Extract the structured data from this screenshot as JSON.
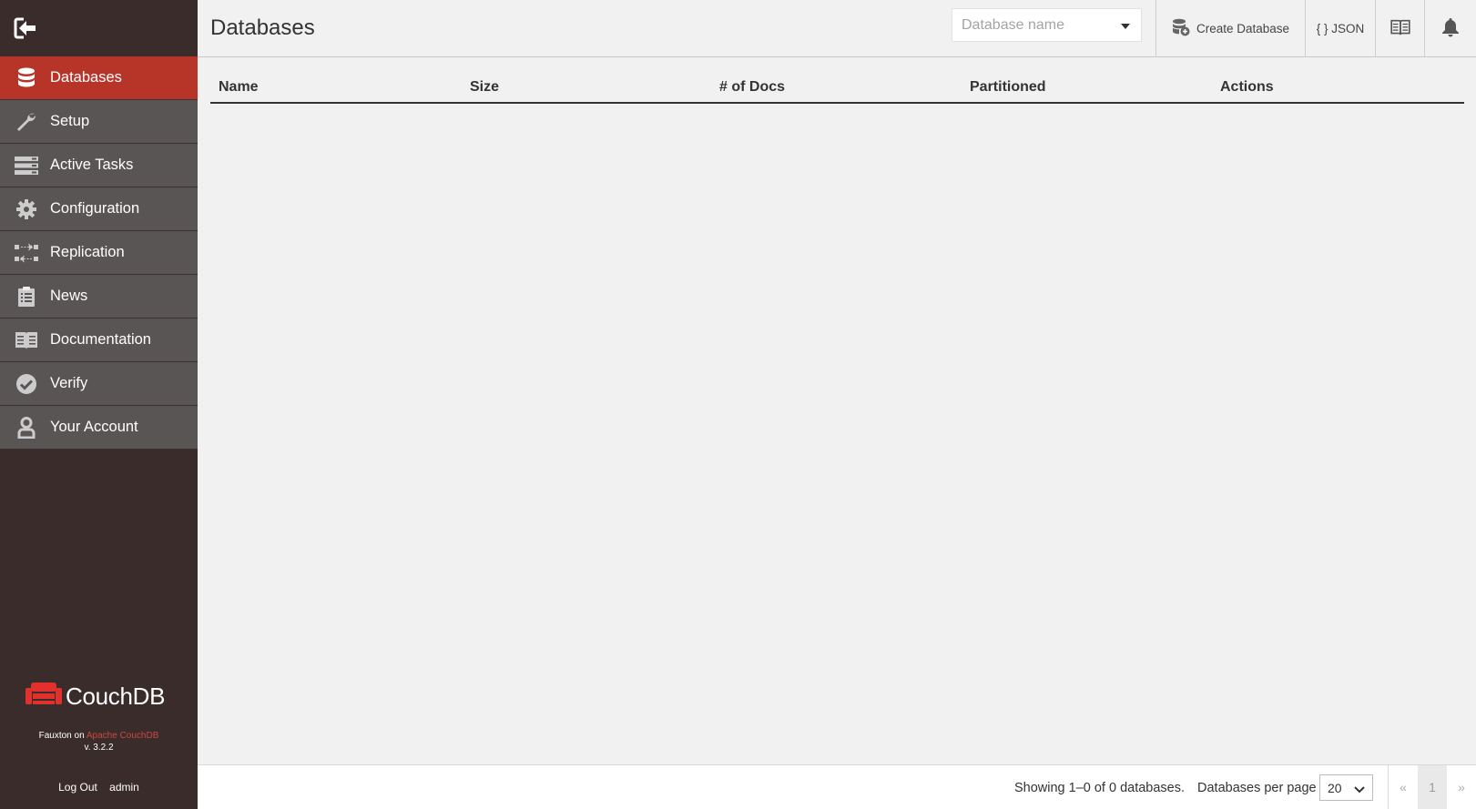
{
  "header": {
    "title": "Databases",
    "db_placeholder": "Database name",
    "create_label": "Create Database",
    "json_label": "{ } JSON"
  },
  "sidebar": {
    "items": [
      {
        "label": "Databases",
        "icon": "database-icon",
        "active": true
      },
      {
        "label": "Setup",
        "icon": "wrench-icon"
      },
      {
        "label": "Active Tasks",
        "icon": "tasks-icon"
      },
      {
        "label": "Configuration",
        "icon": "gear-icon"
      },
      {
        "label": "Replication",
        "icon": "replication-icon"
      },
      {
        "label": "News",
        "icon": "clipboard-icon"
      },
      {
        "label": "Documentation",
        "icon": "book-icon"
      },
      {
        "label": "Verify",
        "icon": "check-circle-icon"
      },
      {
        "label": "Your Account",
        "icon": "user-icon"
      }
    ],
    "brand": "CouchDB",
    "fauxton_prefix": "Fauxton on",
    "fauxton_link": "Apache CouchDB",
    "version": "v. 3.2.2",
    "logout": "Log Out",
    "username": "admin"
  },
  "table": {
    "columns": [
      "Name",
      "Size",
      "# of Docs",
      "Partitioned",
      "Actions"
    ],
    "rows": []
  },
  "footer": {
    "showing": "Showing 1–0 of 0 databases.",
    "per_page_label": "Databases per page",
    "per_page_value": "20",
    "pager": {
      "prev": "«",
      "current": "1",
      "next": "»"
    }
  },
  "colors": {
    "sidebar_bg": "#3a2c2b",
    "nav_item_bg": "#5a5555",
    "active_accent": "#b73428",
    "brand_red": "#e2302d"
  }
}
